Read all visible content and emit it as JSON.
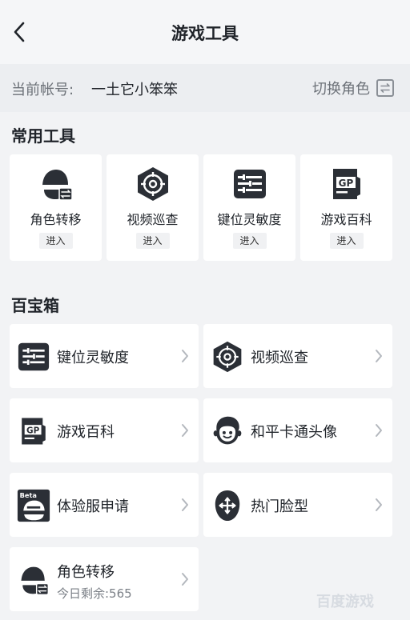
{
  "header": {
    "title": "游戏工具",
    "back_icon": "chevron-left-icon"
  },
  "account": {
    "label": "当前帐号:",
    "name": "一土它小笨笨",
    "switch_label": "切换角色",
    "switch_icon": "swap-icon"
  },
  "common_tools": {
    "title": "常用工具",
    "items": [
      {
        "name": "角色转移",
        "action": "进入",
        "icon": "helmet-transfer-icon"
      },
      {
        "name": "视频巡查",
        "action": "进入",
        "icon": "crosshair-hex-icon"
      },
      {
        "name": "键位灵敏度",
        "action": "进入",
        "icon": "sliders-icon"
      },
      {
        "name": "游戏百科",
        "action": "进入",
        "icon": "gp-book-icon"
      }
    ]
  },
  "treasure_box": {
    "title": "百宝箱",
    "items": [
      {
        "name": "键位灵敏度",
        "icon": "sliders-icon"
      },
      {
        "name": "视频巡查",
        "icon": "crosshair-hex-icon"
      },
      {
        "name": "游戏百科",
        "icon": "gp-book-icon"
      },
      {
        "name": "和平卡通头像",
        "icon": "cartoon-face-icon"
      },
      {
        "name": "体验服申请",
        "icon": "beta-helmet-icon",
        "badge": "Beta"
      },
      {
        "name": "热门脸型",
        "icon": "face-move-icon"
      },
      {
        "name": "角色转移",
        "sub": "今日剩余:565",
        "icon": "helmet-transfer-icon"
      }
    ]
  },
  "watermark": "百度游戏",
  "colors": {
    "icon_dark": "#2b2f36",
    "background": "#f2f3f5",
    "card": "#ffffff",
    "muted_text": "#6c7178"
  }
}
